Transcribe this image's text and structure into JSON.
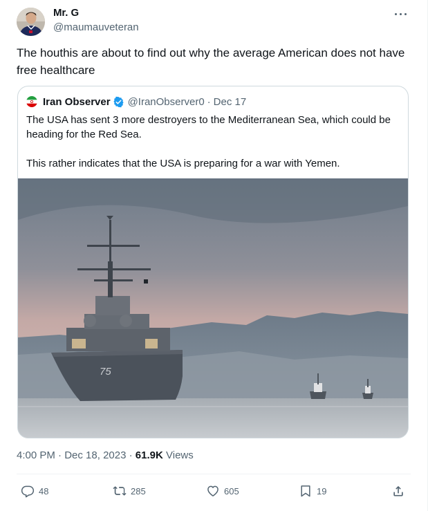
{
  "author": {
    "display_name": "Mr. G",
    "handle": "@maumauveteran",
    "avatar_icon": "profile-photo-icon"
  },
  "tweet": {
    "text": "The houthis are about to find out why the average American does not have free healthcare"
  },
  "quoted_tweet": {
    "display_name": "Iran Observer",
    "handle": "@IranObserver0",
    "separator": "·",
    "date": "Dec 17",
    "paragraphs": [
      "The USA has sent 3 more destroyers to the Mediterranean Sea, which could be heading for the Red Sea.",
      "This rather indicates that the USA is preparing for a war with Yemen."
    ],
    "image": {
      "hull_number": "75"
    }
  },
  "meta": {
    "time": "4:00 PM",
    "separator": "·",
    "date": "Dec 18, 2023",
    "separator2": "·",
    "views_count": "61.9K",
    "views_label": "Views"
  },
  "actions": {
    "replies": "48",
    "reposts": "285",
    "likes": "605",
    "bookmarks": "19"
  },
  "colors": {
    "text_primary": "#0f1419",
    "text_secondary": "#536471",
    "border": "#cfd9de",
    "verified_blue": "#1d9bf0"
  }
}
